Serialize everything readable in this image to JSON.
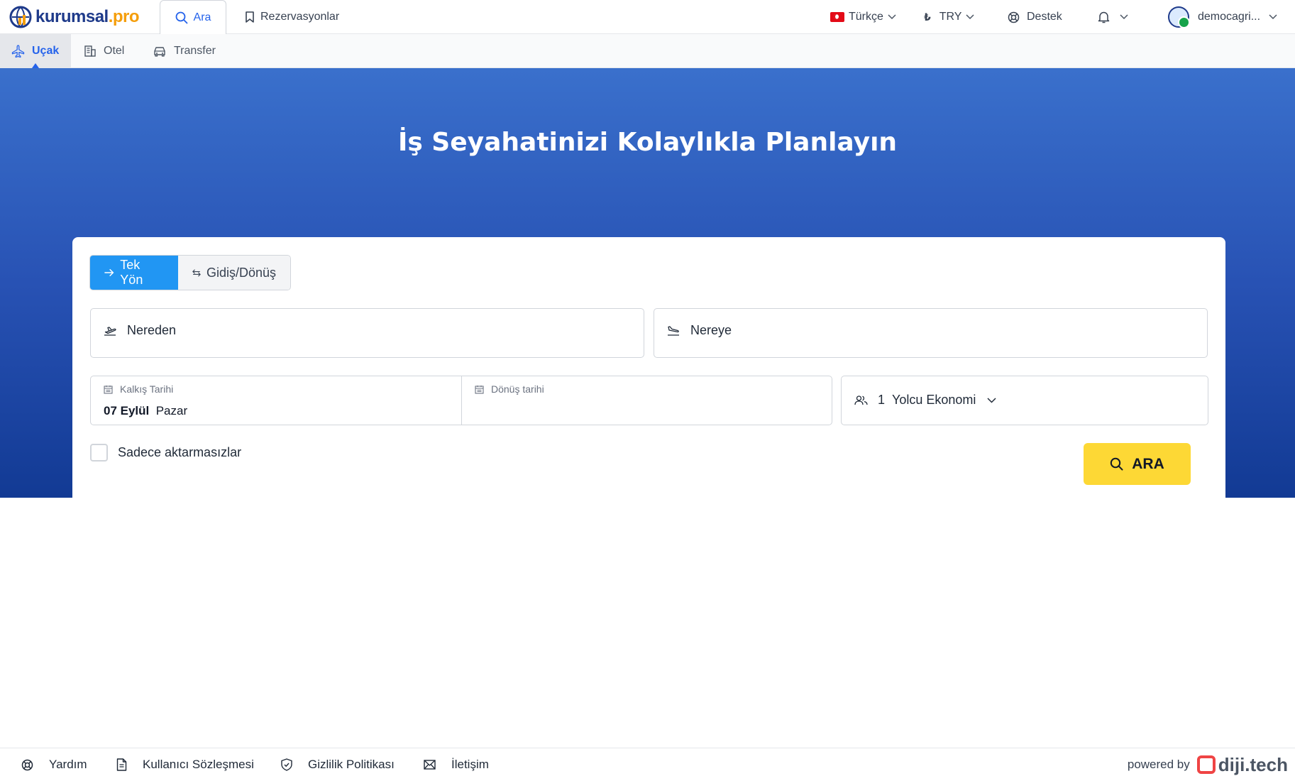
{
  "brand": {
    "name": "kurumsal",
    "suffix": ".pro"
  },
  "topnav": {
    "search_tab": "Ara",
    "reservations_tab": "Rezervasyonlar",
    "language": "Türkçe",
    "currency_symbol": "₺",
    "currency": "TRY",
    "support": "Destek",
    "username": "democagri..."
  },
  "subnav": {
    "flight": "Uçak",
    "hotel": "Otel",
    "transfer": "Transfer"
  },
  "hero": {
    "title": "İş Seyahatinizi Kolaylıkla Planlayın"
  },
  "search": {
    "one_way": "Tek Yön",
    "round_trip": "Gidiş/Dönüş",
    "from_placeholder": "Nereden",
    "to_placeholder": "Nereye",
    "departure_label": "Kalkış Tarihi",
    "departure_day": "07 Eylül",
    "departure_weekday": "Pazar",
    "return_label": "Dönüş tarihi",
    "passenger_count": "1",
    "passenger_class": "Yolcu Ekonomi",
    "nonstop_label": "Sadece aktarmasızlar",
    "search_button": "ARA"
  },
  "footer": {
    "help": "Yardım",
    "terms": "Kullanıcı Sözleşmesi",
    "privacy": "Gizlilik Politikası",
    "contact": "İletişim",
    "powered_by": "powered by",
    "vendor": "diji.tech"
  },
  "colors": {
    "primary": "#2196f3",
    "link": "#2563eb",
    "search_button": "#fdd835",
    "hero_top": "#3a70cc",
    "hero_bottom": "#123a94"
  }
}
